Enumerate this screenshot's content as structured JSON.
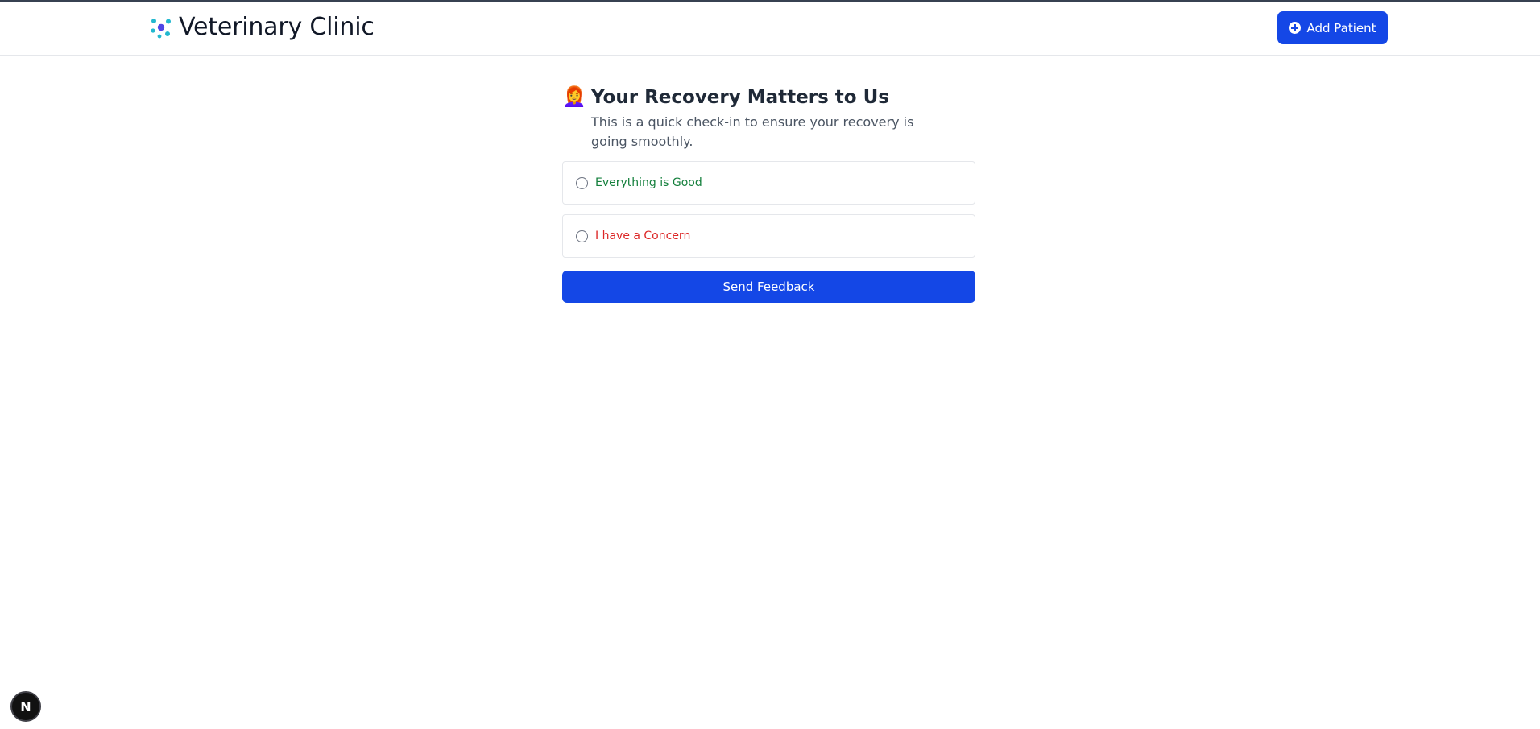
{
  "header": {
    "title": "Veterinary Clinic",
    "add_button_label": "Add Patient",
    "logo_icon": "molecule-icon",
    "accent_color": "#1447e6"
  },
  "feedback": {
    "emoji": "👩‍🦰",
    "title": "Your Recovery Matters to Us",
    "subtitle": "This is a quick check-in to ensure your recovery is going smoothly.",
    "options": [
      {
        "label": "Everything is Good",
        "color": "#15803d",
        "selected": false
      },
      {
        "label": "I have a Concern",
        "color": "#dc2626",
        "selected": false
      }
    ],
    "submit_label": "Send Feedback"
  },
  "dev_badge": {
    "label": "N"
  }
}
